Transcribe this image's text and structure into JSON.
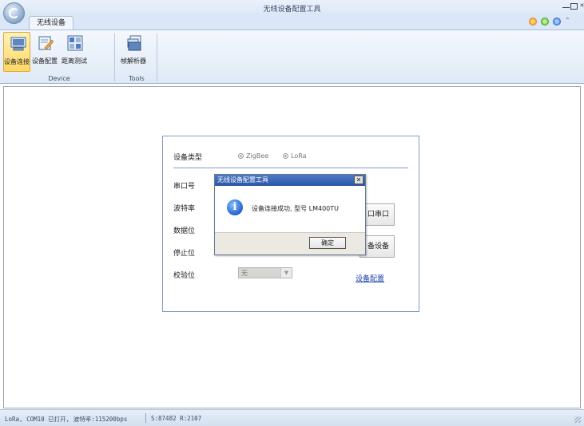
{
  "window": {
    "title": "无线设备配置工具",
    "controls": [
      "minimize",
      "maximize",
      "close"
    ]
  },
  "tabs": [
    {
      "label": "无线设备",
      "active": true
    }
  ],
  "ribbon": {
    "groups": [
      {
        "label": "Device",
        "buttons": [
          {
            "label": "设备连接",
            "icon": "device-connect-icon",
            "selected": true
          },
          {
            "label": "设备配置",
            "icon": "device-config-icon",
            "selected": false
          },
          {
            "label": "距离测试",
            "icon": "distance-test-icon",
            "selected": false
          }
        ]
      },
      {
        "label": "Tools",
        "buttons": [
          {
            "label": "帧解析器",
            "icon": "frame-parser-icon",
            "selected": false
          }
        ]
      }
    ]
  },
  "form": {
    "device_type_label": "设备类型",
    "device_types": [
      {
        "label": "ZigBee",
        "selected": false
      },
      {
        "label": "LoRa",
        "selected": false
      }
    ],
    "serial_port_label": "串口号",
    "baud_rate_label": "波特率",
    "data_bits_label": "数据位",
    "stop_bits_label": "停止位",
    "parity_label": "校验位",
    "parity_value": "无",
    "open_port_button": "口串口",
    "connect_device_button": "备设备",
    "device_config_link": "设备配置"
  },
  "dialog": {
    "title": "无线设备配置工具",
    "message": "设备连接成功, 型号 LM400TU",
    "ok_label": "确定",
    "icon": "info-icon"
  },
  "status": {
    "connection": "LoRa, COM10 已打开, 波特率:115200bps",
    "stats": "S:87482  R:2107"
  },
  "colors": {
    "ribbon_bg": "#dfe9f6",
    "accent": "#7e9ec4",
    "selected_button": "#ffd863",
    "link": "#1a3fb0",
    "dialog_title": "#2a55a6"
  }
}
